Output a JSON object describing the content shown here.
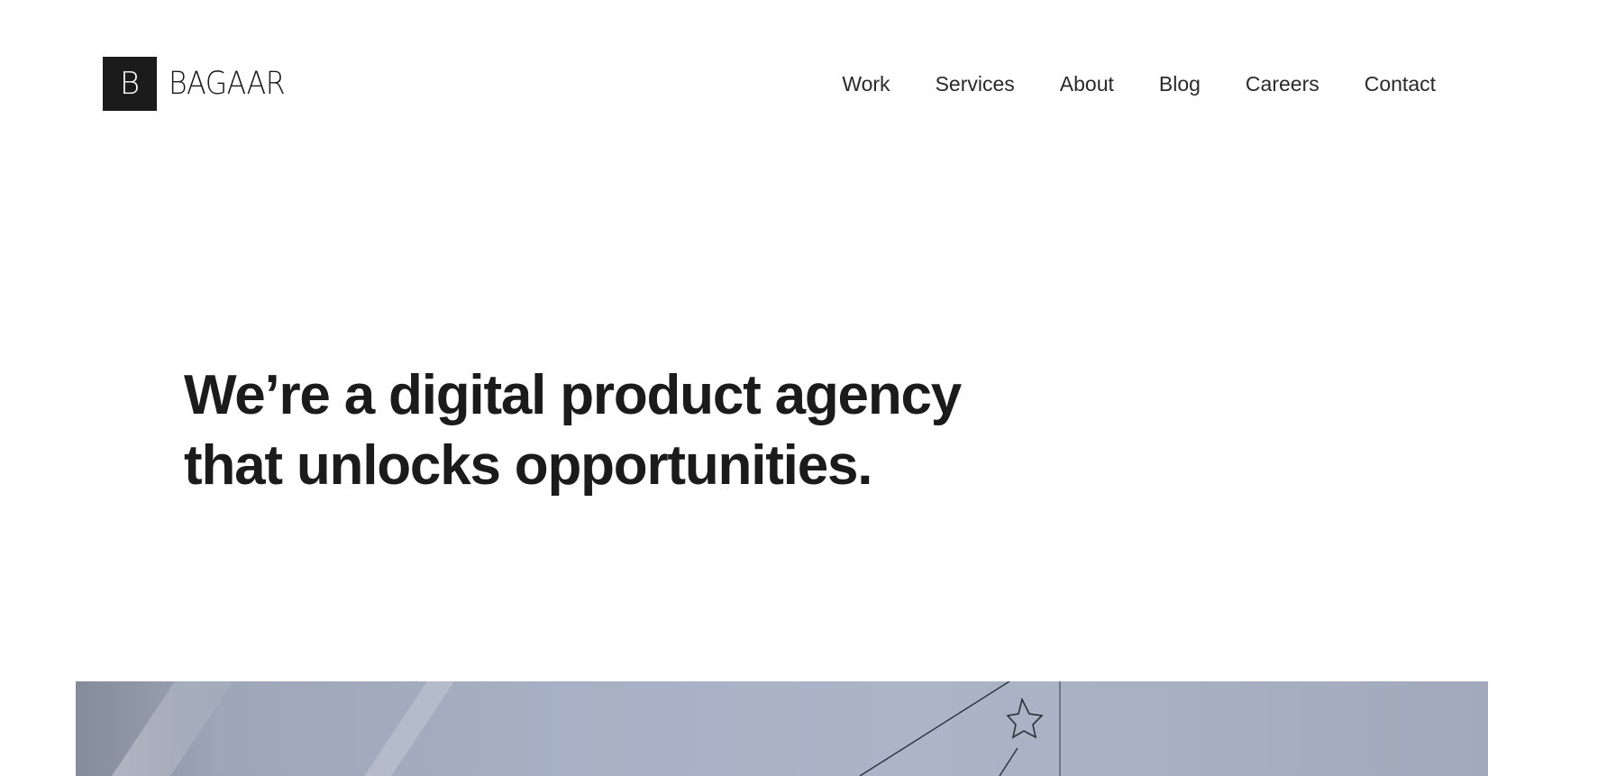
{
  "brand": {
    "mark": "B",
    "name": "BAGAAR"
  },
  "nav": {
    "items": [
      {
        "label": "Work"
      },
      {
        "label": "Services"
      },
      {
        "label": "About"
      },
      {
        "label": "Blog"
      },
      {
        "label": "Careers"
      },
      {
        "label": "Contact"
      }
    ]
  },
  "hero": {
    "title_line1": "We’re a digital product agency",
    "title_line2": "that unlocks opportunities."
  },
  "colors": {
    "text": "#1b1b1b",
    "background": "#ffffff",
    "logo_bg": "#1b1b1b",
    "media_tint": "#a7b0c4"
  }
}
